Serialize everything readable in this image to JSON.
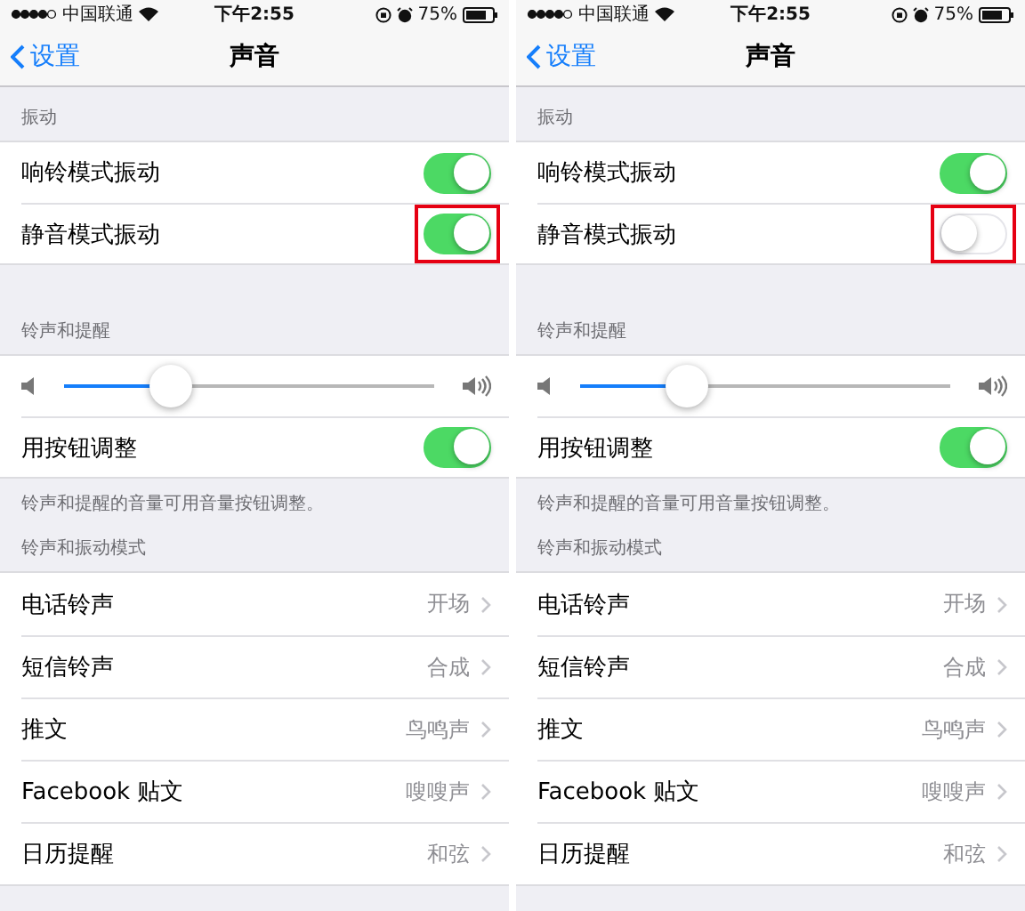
{
  "phones": [
    {
      "status_bar": {
        "carrier": "中国联通",
        "time": "下午2:55",
        "battery": "75%"
      },
      "nav": {
        "back": "设置",
        "title": "声音"
      },
      "sections": [
        {
          "header": "振动",
          "rows": [
            {
              "kind": "toggle",
              "label": "响铃模式振动",
              "on": true,
              "highlighted": false
            },
            {
              "kind": "toggle",
              "label": "静音模式振动",
              "on": true,
              "highlighted": true
            }
          ]
        },
        {
          "header": "铃声和提醒",
          "rows": [
            {
              "kind": "slider",
              "level": 0.29
            },
            {
              "kind": "toggle",
              "label": "用按钮调整",
              "on": true,
              "highlighted": false
            }
          ],
          "footer": "铃声和提醒的音量可用音量按钮调整。"
        },
        {
          "header": "铃声和振动模式",
          "rows": [
            {
              "kind": "link",
              "label": "电话铃声",
              "value": "开场"
            },
            {
              "kind": "link",
              "label": "短信铃声",
              "value": "合成"
            },
            {
              "kind": "link",
              "label": "推文",
              "value": "鸟鸣声"
            },
            {
              "kind": "link",
              "label": "Facebook 贴文",
              "value": "嗖嗖声"
            },
            {
              "kind": "link",
              "label": "日历提醒",
              "value": "和弦"
            }
          ]
        }
      ]
    },
    {
      "status_bar": {
        "carrier": "中国联通",
        "time": "下午2:55",
        "battery": "75%"
      },
      "nav": {
        "back": "设置",
        "title": "声音"
      },
      "sections": [
        {
          "header": "振动",
          "rows": [
            {
              "kind": "toggle",
              "label": "响铃模式振动",
              "on": true,
              "highlighted": false
            },
            {
              "kind": "toggle",
              "label": "静音模式振动",
              "on": false,
              "highlighted": true
            }
          ]
        },
        {
          "header": "铃声和提醒",
          "rows": [
            {
              "kind": "slider",
              "level": 0.29
            },
            {
              "kind": "toggle",
              "label": "用按钮调整",
              "on": true,
              "highlighted": false
            }
          ],
          "footer": "铃声和提醒的音量可用音量按钮调整。"
        },
        {
          "header": "铃声和振动模式",
          "rows": [
            {
              "kind": "link",
              "label": "电话铃声",
              "value": "开场"
            },
            {
              "kind": "link",
              "label": "短信铃声",
              "value": "合成"
            },
            {
              "kind": "link",
              "label": "推文",
              "value": "鸟鸣声"
            },
            {
              "kind": "link",
              "label": "Facebook 贴文",
              "value": "嗖嗖声"
            },
            {
              "kind": "link",
              "label": "日历提醒",
              "value": "和弦"
            }
          ]
        }
      ]
    }
  ]
}
